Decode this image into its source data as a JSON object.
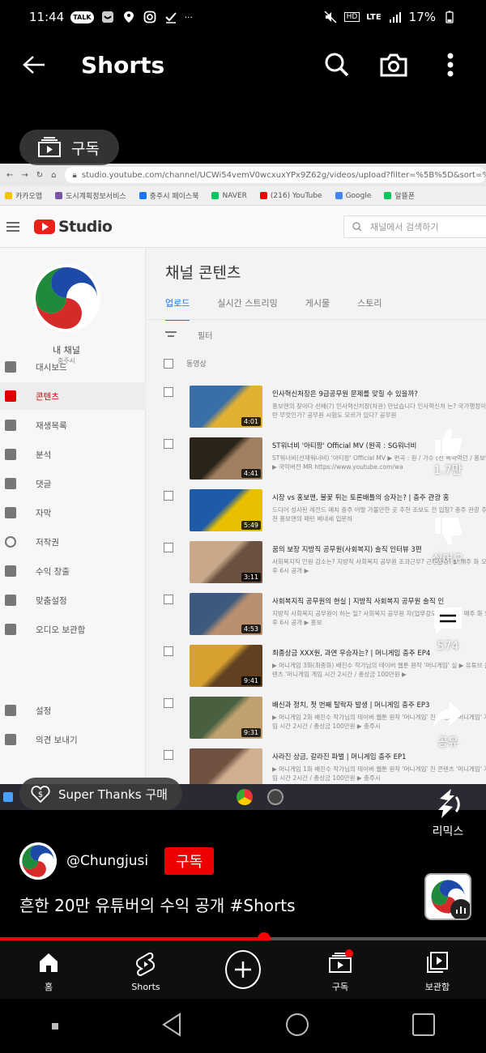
{
  "status_bar": {
    "time": "11:44",
    "talk_badge": "TALK",
    "more": "···",
    "hd": "HD",
    "lte": "LTE",
    "battery": "17%"
  },
  "header": {
    "title": "Shorts"
  },
  "subscribe_chip": {
    "label": "구독"
  },
  "video": {
    "url": "studio.youtube.com/channel/UCWi54vemV0wcxuxYPx9Z62g/videos/upload?filter=%5B%5D&sort=%",
    "bookmarks": [
      {
        "label": "카카오맵",
        "color": "#f4c400"
      },
      {
        "label": "도시계획정보서비스",
        "color": "#7a56a8"
      },
      {
        "label": "충주시 페이스북",
        "color": "#1877f2"
      },
      {
        "label": "NAVER",
        "color": "#03c75a"
      },
      {
        "label": "(216) YouTube",
        "color": "#e00"
      },
      {
        "label": "Google",
        "color": "#4285f4"
      },
      {
        "label": "알뜰폰",
        "color": "#03c75a"
      }
    ],
    "studio_word": "Studio",
    "search_placeholder": "채널에서 검색하기",
    "channel": {
      "name": "내 채널",
      "sub": "충주시"
    },
    "sidebar": [
      {
        "label": "대시보드",
        "active": false
      },
      {
        "label": "콘텐츠",
        "active": true
      },
      {
        "label": "재생목록",
        "active": false
      },
      {
        "label": "분석",
        "active": false
      },
      {
        "label": "댓글",
        "active": false
      },
      {
        "label": "자막",
        "active": false
      },
      {
        "label": "저작권",
        "active": false
      },
      {
        "label": "수익 창출",
        "active": false
      },
      {
        "label": "맞춤설정",
        "active": false
      },
      {
        "label": "오디오 보관함",
        "active": false
      },
      {
        "label": "설정",
        "active": false
      },
      {
        "label": "의견 보내기",
        "active": false
      }
    ],
    "content_title": "채널 콘텐츠",
    "tabs": [
      "업로드",
      "실시간 스트리밍",
      "게시물",
      "스토리"
    ],
    "filter_label": "필터",
    "column_header": "동영상",
    "rows": [
      {
        "title": "인사혁신처장은 9급공무원 문제를 맞힐 수 있을까?",
        "desc": "홍보맨의 찾아다 선배(?) 인사혁신처장(차관) 만났습니다 인사혁신처 는? 국가행정이란 무엇인가? 공무원 시험도 모르가 있다? 공무원",
        "duration": "4:01",
        "colors": [
          "#3a6ea8",
          "#e0b030"
        ]
      },
      {
        "title": "ST워너비 '아티팡' Official MV (원곡 : SG워너비",
        "desc": "ST워너비(선재워너비) '아티팡' Official MV ▶ 편곡 : 원 / 가수 (선 특약먹던 / 홍보맨 ▶ 국악버전 MR https://www.youtube.com/wa",
        "duration": "4:41",
        "colors": [
          "#2a2418",
          "#a08060"
        ]
      },
      {
        "title": "시장 vs 홍보맨, 불꽃 튀는 토론배틀의 승자는? | 충주 관광 홍",
        "desc": "드디어 성사된 레전드 매치 충주 어떻 가볼만한 곳 추천 조보도 전 입장? 충주 관광 추천 홍보맨의 패턴 배내세 입문하",
        "duration": "5:49",
        "colors": [
          "#1d5aa8",
          "#e8c000"
        ]
      },
      {
        "title": "꿈의 보장 지방직 공무원(사회복지) 솔직 인터뷰 3편",
        "desc": "사회복지직 인원 감소는? 지방직 사회복지 공무원 조과근무? 근무환경? ▶ 매주 화 오후 6시 공개 ▶",
        "duration": "3:11",
        "colors": [
          "#c8a888",
          "#6a5040"
        ]
      },
      {
        "title": "사회복지직 공무원의 현실 | 지방직 사회복지 공무원 솔직 인",
        "desc": "지방직 사회복지 공무원이 하는 일? 사회복지 공무원 자(업무강도) 업무? ▶ 매주 화 오후 6시 공개 ▶ 홍보",
        "duration": "4:53",
        "colors": [
          "#3c5a80",
          "#b89070"
        ]
      },
      {
        "title": "최종상금 XXX원, 과연 우승자는? | 머니게임 충주 EP4",
        "desc": "▶ 머니게임 3화(최종화) 배진수 작가님의 테이버 웹툰 원작 '머니게임' 실 ▶ 유튜브 콘텐츠 '머니게임 게임 시간 2시간 / 총상금 100만원 ▶",
        "duration": "9:41",
        "colors": [
          "#d8a030",
          "#604020"
        ]
      },
      {
        "title": "배신과 정치, 첫 번째 탈락자 발생 | 머니게임 충주 EP3",
        "desc": "▶ 머니게임 2화 배진수 작가님의 테이버 웹툰 원작 '머니게임' 진 콘텐츠 '머니게임' 게임 시간 2시간 / 총상금 100만원 ▶ 충주시",
        "duration": "9:31",
        "colors": [
          "#486040",
          "#c0a070"
        ]
      },
      {
        "title": "사라진 상금, 갈라진 파벌 | 머니게임 충주 EP1",
        "desc": "▶ 머니게임 1화 배진수 작가님의 테이버 웹툰 원작 '머니게임' 진 콘텐츠 '머니게임' 게임 시간 2시간 / 총상금 100만원 ▶ 충주시",
        "duration": "",
        "colors": [
          "#705040",
          "#d0b090"
        ]
      }
    ]
  },
  "rail": {
    "like_count": "1.7만",
    "dislike_label": "싫어요",
    "comment_count": "574",
    "share_label": "공유",
    "remix_label": "리믹스"
  },
  "super_thanks": {
    "label": "Super Thanks 구매"
  },
  "channel": {
    "handle": "@Chungjusi",
    "subscribe_label": "구독"
  },
  "short": {
    "title": "흔한 20만 유튜버의 수익 공개 #Shorts",
    "progress": 0.543
  },
  "bottom_nav": [
    {
      "label": "홈",
      "icon": "home-icon"
    },
    {
      "label": "Shorts",
      "icon": "shorts-icon"
    },
    {
      "label": "",
      "icon": "create-icon"
    },
    {
      "label": "구독",
      "icon": "subscriptions-icon"
    },
    {
      "label": "보관함",
      "icon": "library-icon"
    }
  ],
  "colors": {
    "accent": "#ff0000",
    "background": "#000000"
  }
}
